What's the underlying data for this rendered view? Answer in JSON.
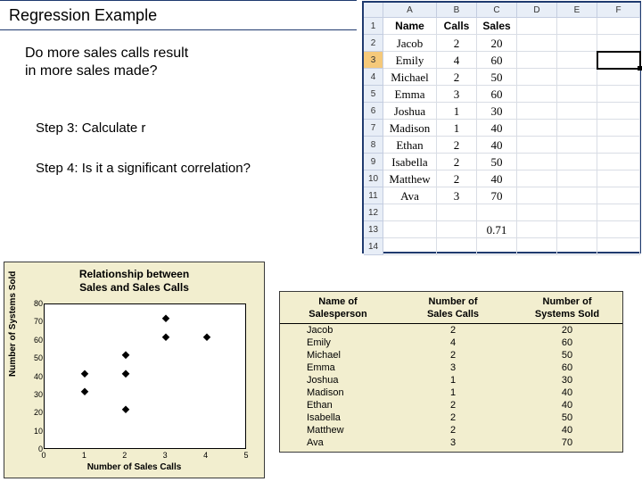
{
  "title": "Regression Example",
  "question_l1": "Do more sales calls result",
  "question_l2": "in more sales made?",
  "step3": "Step 3: Calculate r",
  "step4": "Step 4: Is it a significant correlation?",
  "spreadsheet": {
    "cols": [
      "",
      "A",
      "B",
      "C",
      "D",
      "E",
      "F"
    ],
    "hdr": {
      "a": "Name",
      "b": "Calls",
      "c": "Sales"
    },
    "rows": [
      {
        "n": "2",
        "a": "Jacob",
        "b": "2",
        "c": "20"
      },
      {
        "n": "3",
        "a": "Emily",
        "b": "4",
        "c": "60"
      },
      {
        "n": "4",
        "a": "Michael",
        "b": "2",
        "c": "50"
      },
      {
        "n": "5",
        "a": "Emma",
        "b": "3",
        "c": "60"
      },
      {
        "n": "6",
        "a": "Joshua",
        "b": "1",
        "c": "30"
      },
      {
        "n": "7",
        "a": "Madison",
        "b": "1",
        "c": "40"
      },
      {
        "n": "8",
        "a": "Ethan",
        "b": "2",
        "c": "40"
      },
      {
        "n": "9",
        "a": "Isabella",
        "b": "2",
        "c": "50"
      },
      {
        "n": "10",
        "a": "Matthew",
        "b": "2",
        "c": "40"
      },
      {
        "n": "11",
        "a": "Ava",
        "b": "3",
        "c": "70"
      }
    ],
    "result_row": "13",
    "result": "0.71"
  },
  "data_table": {
    "h1a": "Name of",
    "h1b": "Salesperson",
    "h2a": "Number of",
    "h2b": "Sales Calls",
    "h3a": "Number of",
    "h3b": "Systems Sold",
    "rows": [
      {
        "name": "Jacob",
        "calls": "2",
        "sold": "20"
      },
      {
        "name": "Emily",
        "calls": "4",
        "sold": "60"
      },
      {
        "name": "Michael",
        "calls": "2",
        "sold": "50"
      },
      {
        "name": "Emma",
        "calls": "3",
        "sold": "60"
      },
      {
        "name": "Joshua",
        "calls": "1",
        "sold": "30"
      },
      {
        "name": "Madison",
        "calls": "1",
        "sold": "40"
      },
      {
        "name": "Ethan",
        "calls": "2",
        "sold": "40"
      },
      {
        "name": "Isabella",
        "calls": "2",
        "sold": "50"
      },
      {
        "name": "Matthew",
        "calls": "2",
        "sold": "40"
      },
      {
        "name": "Ava",
        "calls": "3",
        "sold": "70"
      }
    ]
  },
  "chart_data": {
    "type": "scatter",
    "title": "Relationship between\nSales and Sales Calls",
    "xlabel": "Number of Sales Calls",
    "ylabel": "Number of Systems Sold",
    "xlim": [
      0,
      5
    ],
    "ylim": [
      0,
      80
    ],
    "x_ticks": [
      0,
      1,
      2,
      3,
      4,
      5
    ],
    "y_ticks": [
      0,
      10,
      20,
      30,
      40,
      50,
      60,
      70,
      80
    ],
    "points": [
      {
        "x": 2,
        "y": 20
      },
      {
        "x": 4,
        "y": 60
      },
      {
        "x": 2,
        "y": 50
      },
      {
        "x": 3,
        "y": 60
      },
      {
        "x": 1,
        "y": 30
      },
      {
        "x": 1,
        "y": 40
      },
      {
        "x": 2,
        "y": 40
      },
      {
        "x": 2,
        "y": 50
      },
      {
        "x": 2,
        "y": 40
      },
      {
        "x": 3,
        "y": 70
      }
    ]
  }
}
